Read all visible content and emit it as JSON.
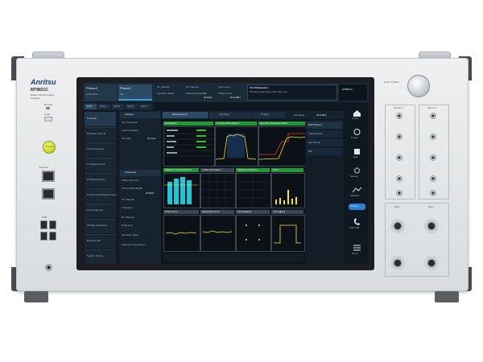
{
  "brand": {
    "logo": "Anritsu",
    "model": "MT8821C",
    "subtitle": "Radio Communication\nAnalyzer"
  },
  "left_panel": {
    "remote_label": "Remote",
    "local_label": "Local",
    "preset_label": "Preset",
    "ethernet_label": "Ethernet",
    "usb_label": "USB"
  },
  "right_panel": {
    "knob_label": "Push To Enter",
    "phone1_label": "Phone 1",
    "phone2_label": "Phone 2",
    "main_label": "Main"
  },
  "screen": {
    "phone_tabs": [
      "Phone2",
      "Phone1"
    ],
    "phone_tab_subs": [
      "Call Status",
      "Idle"
    ],
    "header_labels": [
      "UL Channel",
      "DL Channel",
      "Operation Band",
      "Channel Bandwidth",
      "Input Level",
      "Output Level"
    ],
    "header_values": [
      "20 MHz",
      "-30.0 dBm"
    ],
    "status_title": "Test Parameters",
    "status_text": "The test parameters have been set.",
    "status_logo": "MT8821C",
    "cell_tabs": [
      "PCC",
      "SCC1",
      "SCC2",
      "SCC3",
      "SCC4"
    ],
    "sidebar": [
      "Common",
      "Physical Channel",
      "Call Processing",
      "Tx Measurement",
      "Rx Measurement",
      "Fundamental Measurement",
      "Test Parameter",
      "IP Data Application",
      "External Unit",
      "System Config"
    ],
    "settings_groups": [
      "General",
      "Frequency"
    ],
    "settings_rows": [
      "Test Parameter",
      "Call Processing",
      "Scenario",
      "Frame Structure",
      "Channel Bandwidth",
      "UL Channel",
      "Frequency",
      "DL Channel",
      "Frequency",
      "Operation Band",
      "Frequency Separation"
    ],
    "setting_values": [
      "Normal",
      "20 MHz"
    ],
    "main_tabs": [
      "Measurement",
      "Signalling",
      "IP Data"
    ],
    "ue_power_label": "UE Power",
    "ue_power_value": "23.0 dBm",
    "graph_headers": [
      "Modulation",
      "Occupied Bandwidth",
      "Spectrum Emission Mask",
      "Adjacent Channel Power",
      "In-Band Emission",
      "Spectrum Flatness",
      "EVM",
      "Phase Error",
      "Magnitude Error",
      "Constellation",
      "Throughput"
    ],
    "pass_label": "Pass",
    "right_list": [
      "Start Screen",
      "Fundamental",
      "Get Screen",
      "Slot"
    ],
    "right_icons": [
      "Home",
      "Preset",
      "End",
      "Setting",
      "Measure",
      "Display",
      "Start Call",
      "Menu"
    ]
  },
  "colors": {
    "pass_green": "#1d9a36",
    "screen_bg": "#0f1720",
    "trace_yellow": "#f3e22a",
    "trace_cyan": "#21c6d6",
    "preset_button": "#cfe335"
  }
}
